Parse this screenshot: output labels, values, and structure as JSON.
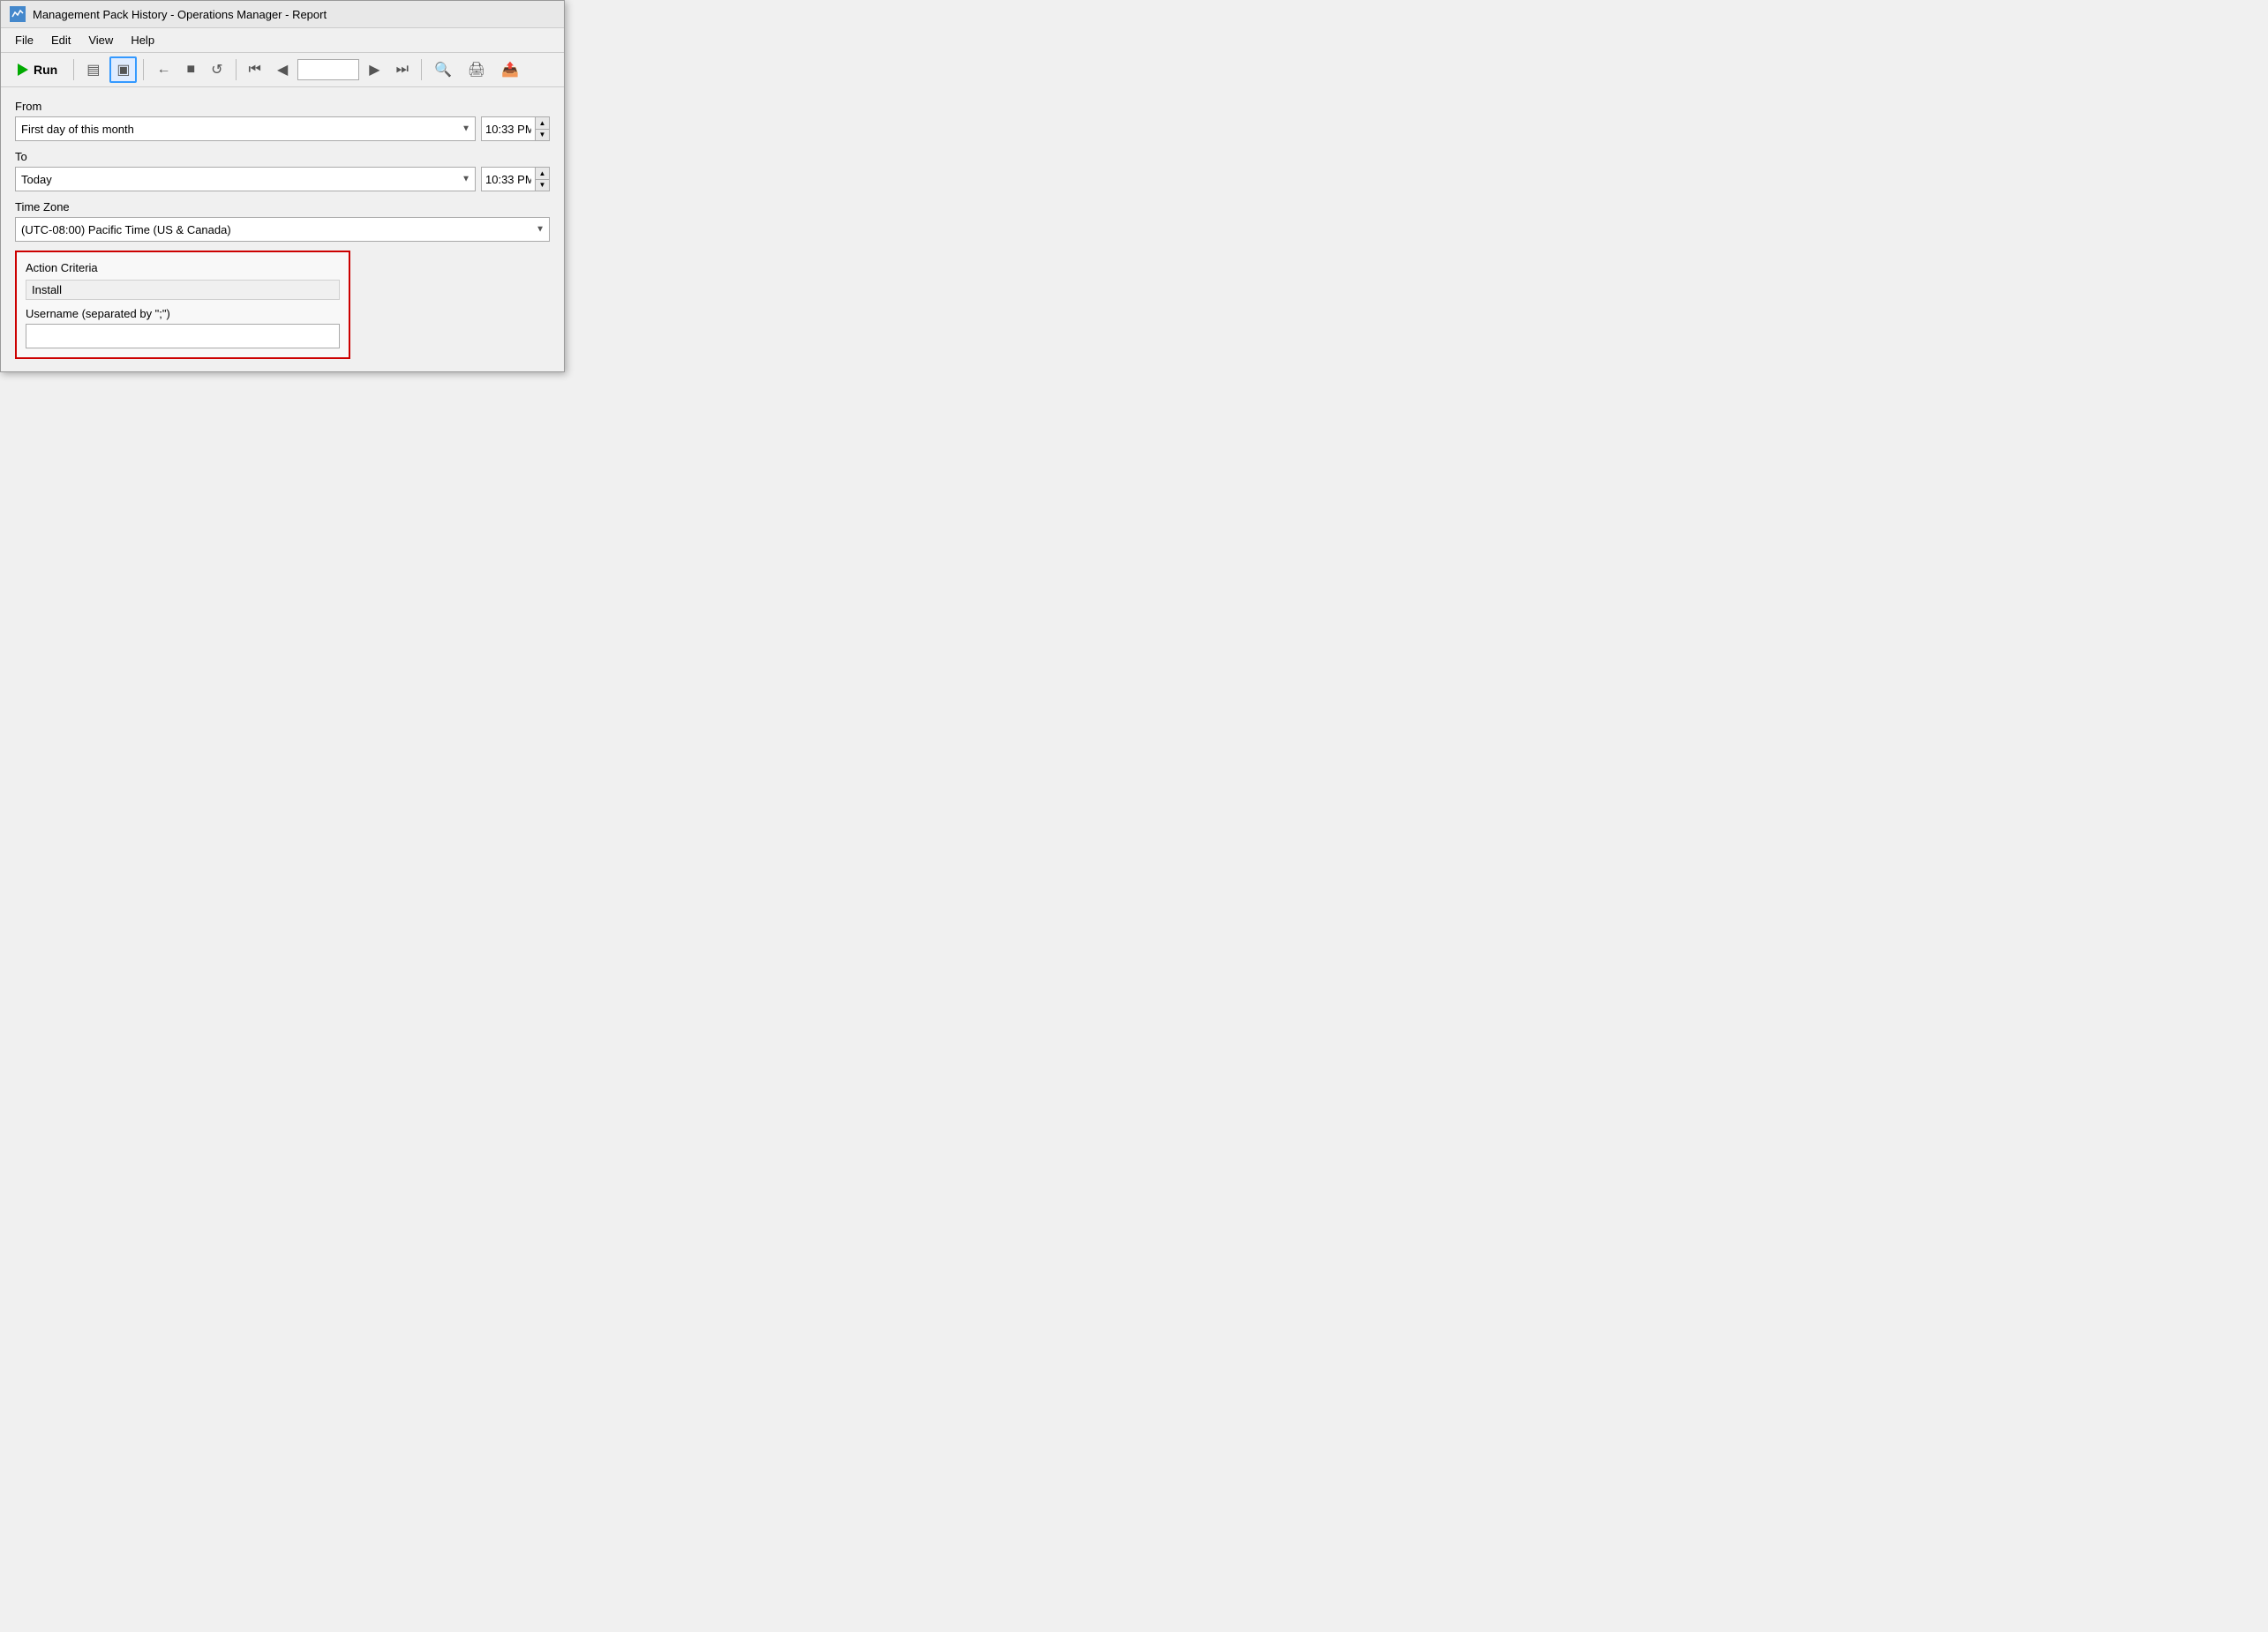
{
  "window": {
    "title": "Management Pack History - Operations Manager - Report",
    "icon": "chart-icon"
  },
  "menu": {
    "items": [
      "File",
      "Edit",
      "View",
      "Help"
    ]
  },
  "toolbar": {
    "run_label": "Run",
    "page_value": "",
    "buttons": [
      {
        "name": "report-view-btn",
        "icon": "▤",
        "active": false
      },
      {
        "name": "page-layout-btn",
        "icon": "▣",
        "active": true
      },
      {
        "name": "back-btn",
        "icon": "←",
        "active": false
      },
      {
        "name": "stop-btn",
        "icon": "■",
        "active": false
      },
      {
        "name": "refresh-btn",
        "icon": "↺",
        "active": false
      },
      {
        "name": "first-page-btn",
        "icon": "⏮",
        "active": false
      },
      {
        "name": "prev-page-btn",
        "icon": "◀",
        "active": false
      },
      {
        "name": "next-page-btn",
        "icon": "▶",
        "active": false
      },
      {
        "name": "last-page-btn",
        "icon": "⏭",
        "active": false
      },
      {
        "name": "zoom-btn",
        "icon": "🔍",
        "active": false
      },
      {
        "name": "print-btn",
        "icon": "🖨",
        "active": false
      },
      {
        "name": "export-btn",
        "icon": "📤",
        "active": false
      }
    ]
  },
  "form": {
    "from_label": "From",
    "from_dropdown_value": "First day of this month",
    "from_time_value": "10:33 PM",
    "to_label": "To",
    "to_dropdown_value": "Today",
    "to_time_value": "10:33 PM",
    "timezone_label": "Time Zone",
    "timezone_value": "(UTC-08:00) Pacific Time (US & Canada)",
    "action_criteria_label": "Action Criteria",
    "action_criteria_value": "Install",
    "username_label": "Username (separated by \";\")",
    "username_value": ""
  }
}
